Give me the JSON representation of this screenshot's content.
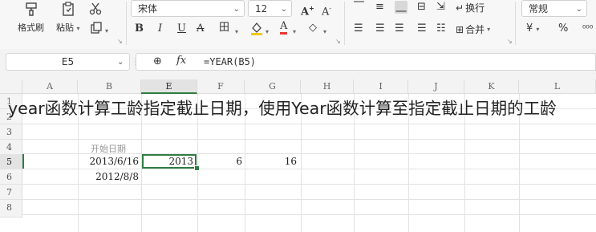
{
  "ribbon": {
    "format_painter": "格式刷",
    "paste": "粘贴",
    "font_name": "宋体",
    "font_size": "12",
    "wrap_text": "换行",
    "merge": "合并",
    "number_format": "常规",
    "currency_symbol": "¥",
    "percent_symbol": "%"
  },
  "formula_bar": {
    "name_box": "E5",
    "fx_label": "fx",
    "formula": "=YEAR(B5)"
  },
  "columns": [
    "A",
    "B",
    "E",
    "F",
    "G",
    "H",
    "I",
    "J",
    "K",
    "L"
  ],
  "rows": [
    "1",
    "2",
    "3",
    "4",
    "5",
    "6",
    "7",
    "8"
  ],
  "cells": {
    "b4": "开始日期",
    "b5": "2013/6/16",
    "b6": "2012/8/8",
    "e5": "2013",
    "f5": "6",
    "g5": "16"
  },
  "overlay_text": "year函数计算工龄指定截止日期，使用Year函数计算至指定截止日期的工龄",
  "colors": {
    "accent_green": "#2f7d43",
    "font_color_red": "#e53935",
    "fill_yellow": "#f2c811"
  }
}
